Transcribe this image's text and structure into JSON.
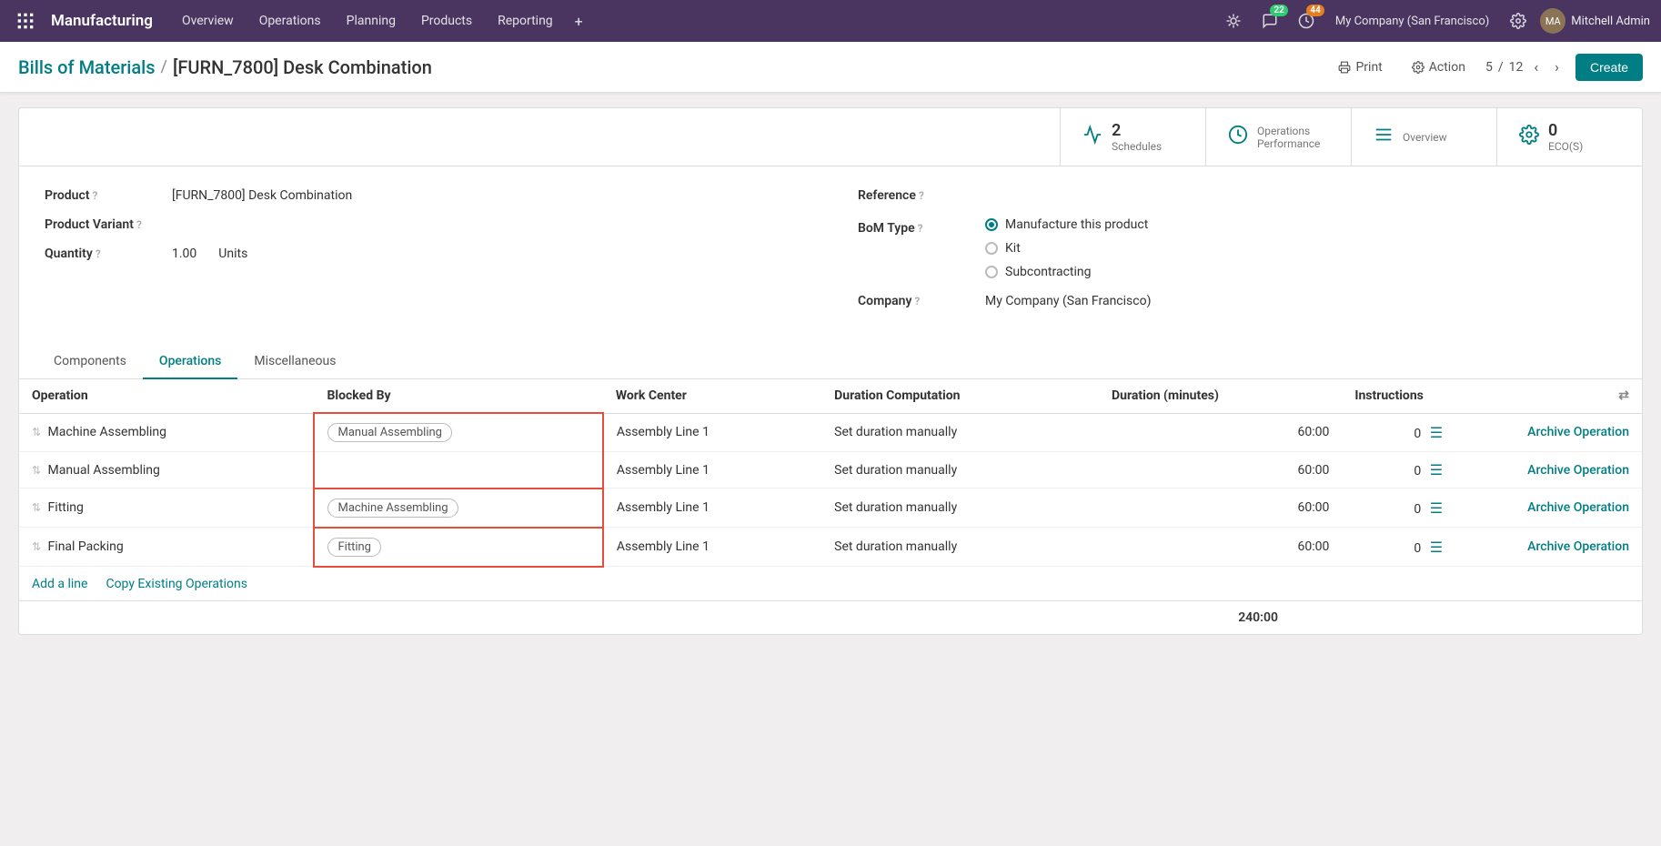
{
  "app": {
    "name": "Manufacturing"
  },
  "nav": {
    "items": [
      "Overview",
      "Operations",
      "Planning",
      "Products",
      "Reporting"
    ],
    "company": "My Company (San Francisco)",
    "username": "Mitchell Admin",
    "badge_chat": "22",
    "badge_activity": "44"
  },
  "breadcrumb": {
    "parent": "Bills of Materials",
    "separator": "/",
    "current": "[FURN_7800] Desk Combination"
  },
  "actions": {
    "print": "Print",
    "action": "Action",
    "page_current": "5",
    "page_total": "12",
    "create": "Create"
  },
  "stat_buttons": [
    {
      "icon": "chart",
      "count": "2",
      "label": "Schedules"
    },
    {
      "icon": "clock",
      "count": "",
      "label": "Operations Performance"
    },
    {
      "icon": "list",
      "count": "",
      "label": "Overview"
    },
    {
      "icon": "gear",
      "count": "0",
      "label": "ECO(S)"
    }
  ],
  "form": {
    "product_label": "Product",
    "product_value": "[FURN_7800] Desk Combination",
    "product_variant_label": "Product Variant",
    "quantity_label": "Quantity",
    "quantity_value": "1.00",
    "quantity_unit": "Units",
    "reference_label": "Reference",
    "bom_type_label": "BoM Type",
    "bom_options": [
      "Manufacture this product",
      "Kit",
      "Subcontracting"
    ],
    "bom_selected": "Manufacture this product",
    "company_label": "Company",
    "company_value": "My Company (San Francisco)"
  },
  "tabs": [
    {
      "label": "Components",
      "active": false
    },
    {
      "label": "Operations",
      "active": true
    },
    {
      "label": "Miscellaneous",
      "active": false
    }
  ],
  "operations_table": {
    "columns": [
      "Operation",
      "Blocked By",
      "Work Center",
      "Duration Computation",
      "Duration (minutes)",
      "Instructions"
    ],
    "rows": [
      {
        "operation": "Machine Assembling",
        "blocked_by": "Manual Assembling",
        "work_center": "Assembly Line 1",
        "duration_computation": "Set duration manually",
        "duration_minutes": "60:00",
        "instructions_count": "0",
        "action_label": "Archive Operation"
      },
      {
        "operation": "Manual Assembling",
        "blocked_by": "",
        "work_center": "Assembly Line 1",
        "duration_computation": "Set duration manually",
        "duration_minutes": "60:00",
        "instructions_count": "0",
        "action_label": "Archive Operation"
      },
      {
        "operation": "Fitting",
        "blocked_by": "Machine Assembling",
        "work_center": "Assembly Line 1",
        "duration_computation": "Set duration manually",
        "duration_minutes": "60:00",
        "instructions_count": "0",
        "action_label": "Archive Operation"
      },
      {
        "operation": "Final Packing",
        "blocked_by": "Fitting",
        "work_center": "Assembly Line 1",
        "duration_computation": "Set duration manually",
        "duration_minutes": "60:00",
        "instructions_count": "0",
        "action_label": "Archive Operation"
      }
    ],
    "add_line": "Add a line",
    "copy_existing": "Copy Existing Operations",
    "total": "240:00"
  }
}
